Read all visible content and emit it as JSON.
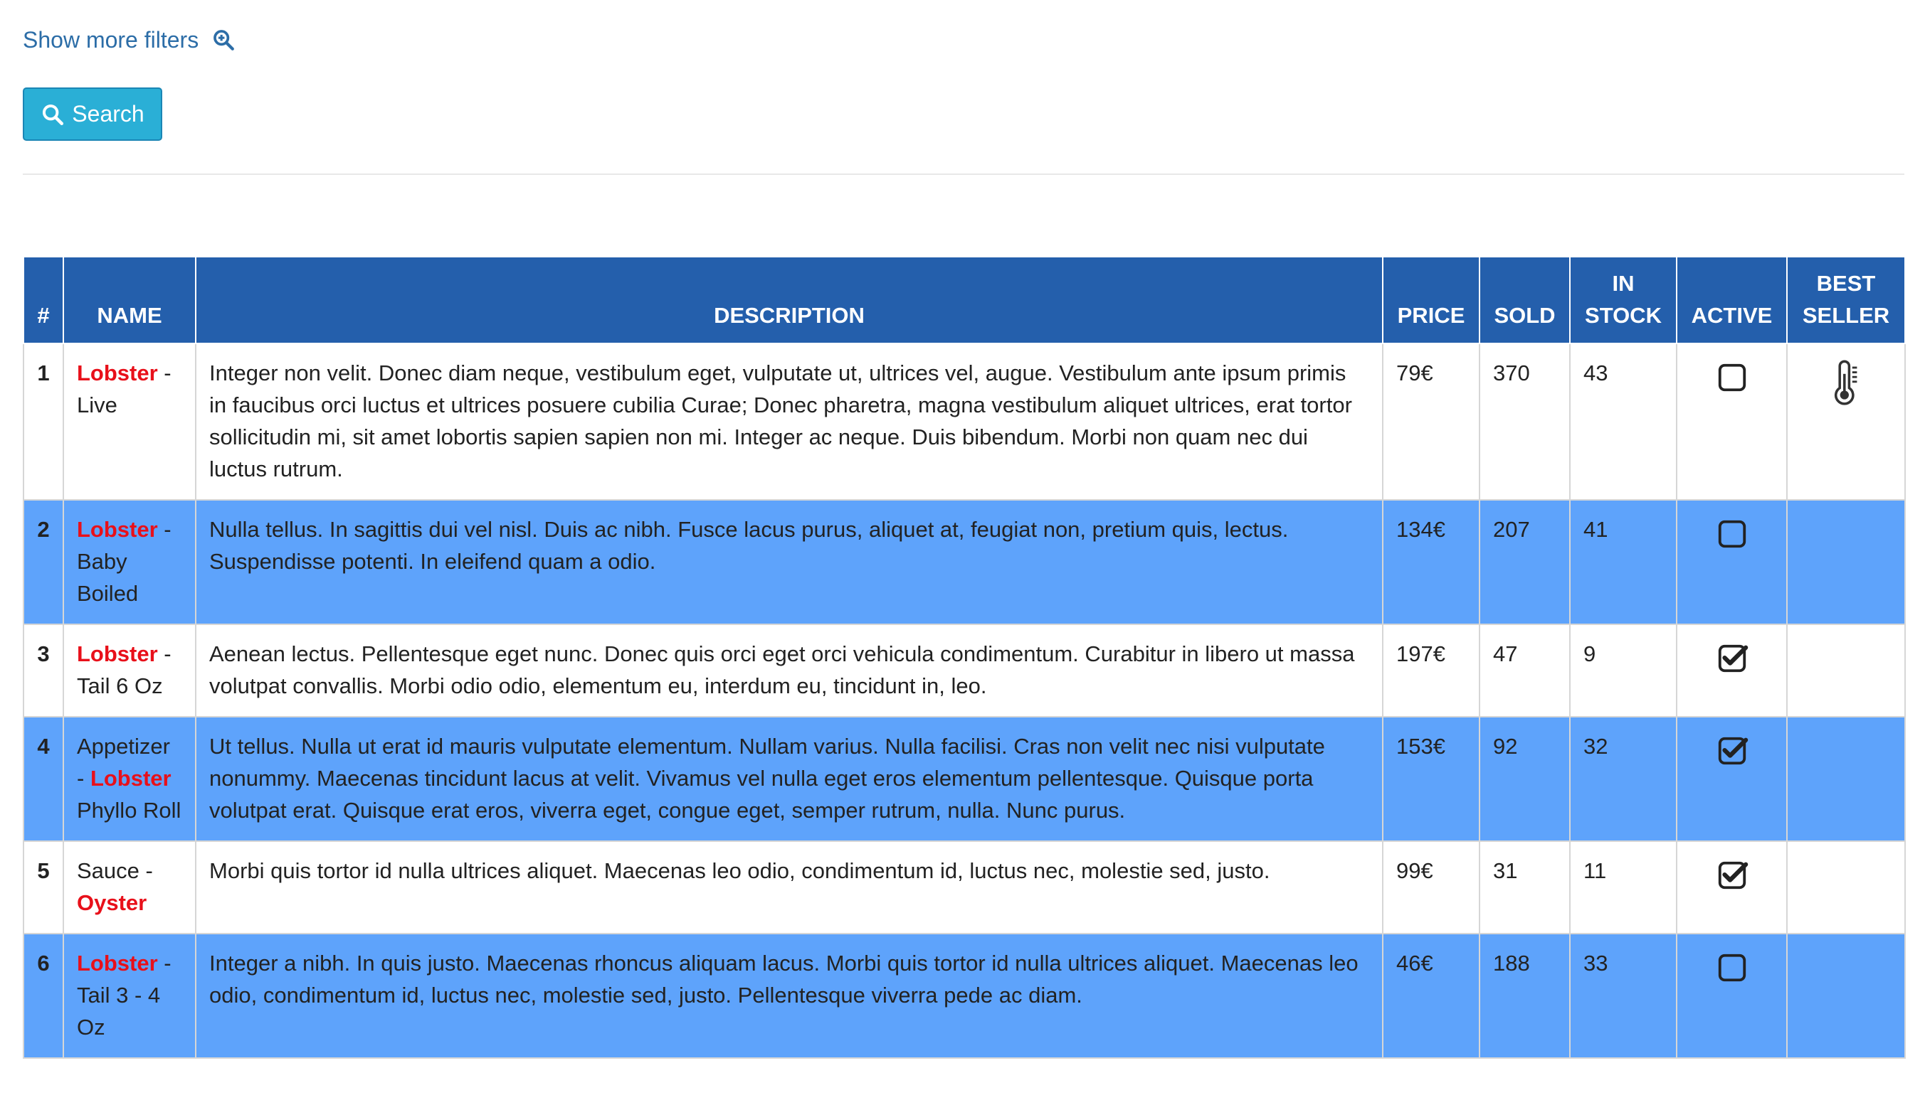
{
  "filters": {
    "show_more_label": "Show more filters",
    "show_more_icon": "zoom-in-icon",
    "search_label": "Search",
    "search_icon": "search-icon"
  },
  "table": {
    "columns": [
      "#",
      "NAME",
      "DESCRIPTION",
      "PRICE",
      "SOLD",
      "IN STOCK",
      "ACTIVE",
      "BEST SELLER"
    ],
    "header_color": "#245fac",
    "highlight_color": "#e8101a",
    "alt_row_color": "#5ea3fb",
    "rows": [
      {
        "index": "1",
        "name": [
          {
            "text": "Lobster",
            "hl": true
          },
          {
            "text": " - Live",
            "hl": false
          }
        ],
        "description": "Integer non velit. Donec diam neque, vestibulum eget, vulputate ut, ultrices vel, augue. Vestibulum ante ipsum primis in faucibus orci luctus et ultrices posuere cubilia Curae; Donec pharetra, magna vestibulum aliquet ultrices, erat tortor sollicitudin mi, sit amet lobortis sapien sapien non mi. Integer ac neque. Duis bibendum. Morbi non quam nec dui luctus rutrum.",
        "price": "79€",
        "sold": "370",
        "in_stock": "43",
        "active": false,
        "best_seller": true
      },
      {
        "index": "2",
        "name": [
          {
            "text": "Lobster",
            "hl": true
          },
          {
            "text": " - Baby Boiled",
            "hl": false
          }
        ],
        "description": "Nulla tellus. In sagittis dui vel nisl. Duis ac nibh. Fusce lacus purus, aliquet at, feugiat non, pretium quis, lectus. Suspendisse potenti. In eleifend quam a odio.",
        "price": "134€",
        "sold": "207",
        "in_stock": "41",
        "active": false,
        "best_seller": false
      },
      {
        "index": "3",
        "name": [
          {
            "text": "Lobster",
            "hl": true
          },
          {
            "text": " - Tail 6 Oz",
            "hl": false
          }
        ],
        "description": "Aenean lectus. Pellentesque eget nunc. Donec quis orci eget orci vehicula condimentum. Curabitur in libero ut massa volutpat convallis. Morbi odio odio, elementum eu, interdum eu, tincidunt in, leo.",
        "price": "197€",
        "sold": "47",
        "in_stock": "9",
        "active": true,
        "best_seller": false
      },
      {
        "index": "4",
        "name": [
          {
            "text": "Appetizer - ",
            "hl": false
          },
          {
            "text": "Lobster",
            "hl": true
          },
          {
            "text": " Phyllo Roll",
            "hl": false
          }
        ],
        "description": "Ut tellus. Nulla ut erat id mauris vulputate elementum. Nullam varius. Nulla facilisi. Cras non velit nec nisi vulputate nonummy. Maecenas tincidunt lacus at velit. Vivamus vel nulla eget eros elementum pellentesque. Quisque porta volutpat erat. Quisque erat eros, viverra eget, congue eget, semper rutrum, nulla. Nunc purus.",
        "price": "153€",
        "sold": "92",
        "in_stock": "32",
        "active": true,
        "best_seller": false
      },
      {
        "index": "5",
        "name": [
          {
            "text": "Sauce - ",
            "hl": false
          },
          {
            "text": "Oyster",
            "hl": true
          }
        ],
        "description": "Morbi quis tortor id nulla ultrices aliquet. Maecenas leo odio, condimentum id, luctus nec, molestie sed, justo.",
        "price": "99€",
        "sold": "31",
        "in_stock": "11",
        "active": true,
        "best_seller": false
      },
      {
        "index": "6",
        "name": [
          {
            "text": "Lobster",
            "hl": true
          },
          {
            "text": " - Tail 3 - 4 Oz",
            "hl": false
          }
        ],
        "description": "Integer a nibh. In quis justo. Maecenas rhoncus aliquam lacus. Morbi quis tortor id nulla ultrices aliquet. Maecenas leo odio, condimentum id, luctus nec, molestie sed, justo. Pellentesque viverra pede ac diam.",
        "price": "46€",
        "sold": "188",
        "in_stock": "33",
        "active": false,
        "best_seller": false
      }
    ]
  }
}
